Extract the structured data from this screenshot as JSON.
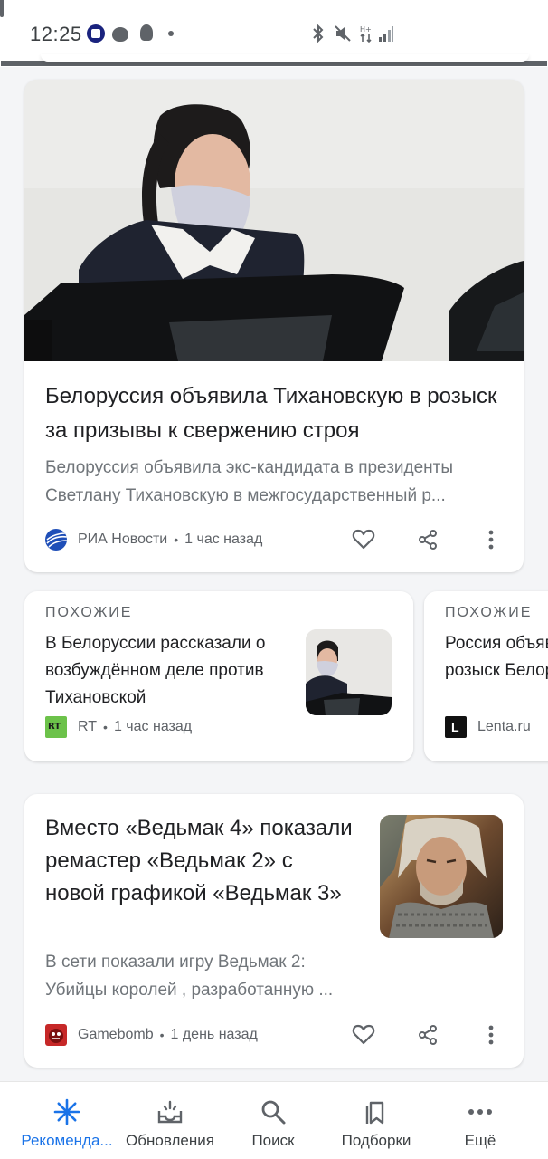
{
  "status_bar": {
    "time": "12:25"
  },
  "main_card": {
    "headline": "Белоруссия объявила Тихановскую в розыск за призывы к свержению строя",
    "snippet": "Белоруссия объявила экс-кандидата в президенты Светлану Тихановскую в межгосударственный р...",
    "source": "РИА Новости",
    "time": "1 час назад",
    "logo_color": "#1f4fb8"
  },
  "related": {
    "label": "ПОХОЖИЕ",
    "items": [
      {
        "title": "В Белоруссии рассказали о возбуждённом деле против Тихановской",
        "source": "RT",
        "time": "1 час назад",
        "logo_text": "RT",
        "logo_color": "#6cc24a"
      },
      {
        "title": "Россия объявила Тихановскую в розыск Белоруссии",
        "source": "Lenta.ru",
        "time": "",
        "logo_text": "L",
        "logo_color": "#111111"
      }
    ]
  },
  "witcher_card": {
    "headline": "Вместо «Ведьмак 4» показали ремастер «Ведьмак 2» с новой графикой «Ведьмак 3»",
    "snippet": "В сети показали игру Ведьмак 2: Убийцы королей , разработанную ...",
    "source": "Gamebomb",
    "time": "1 день назад",
    "logo_color": "#c62828"
  },
  "bottom_nav": {
    "items": [
      {
        "label": "Рекоменда...",
        "icon": "asterisk-icon",
        "active": true
      },
      {
        "label": "Обновления",
        "icon": "inbox-updates-icon",
        "active": false
      },
      {
        "label": "Поиск",
        "icon": "search-icon",
        "active": false
      },
      {
        "label": "Подборки",
        "icon": "collections-icon",
        "active": false
      },
      {
        "label": "Ещё",
        "icon": "more-horiz-icon",
        "active": false
      }
    ],
    "active_color": "#1a73e8"
  }
}
